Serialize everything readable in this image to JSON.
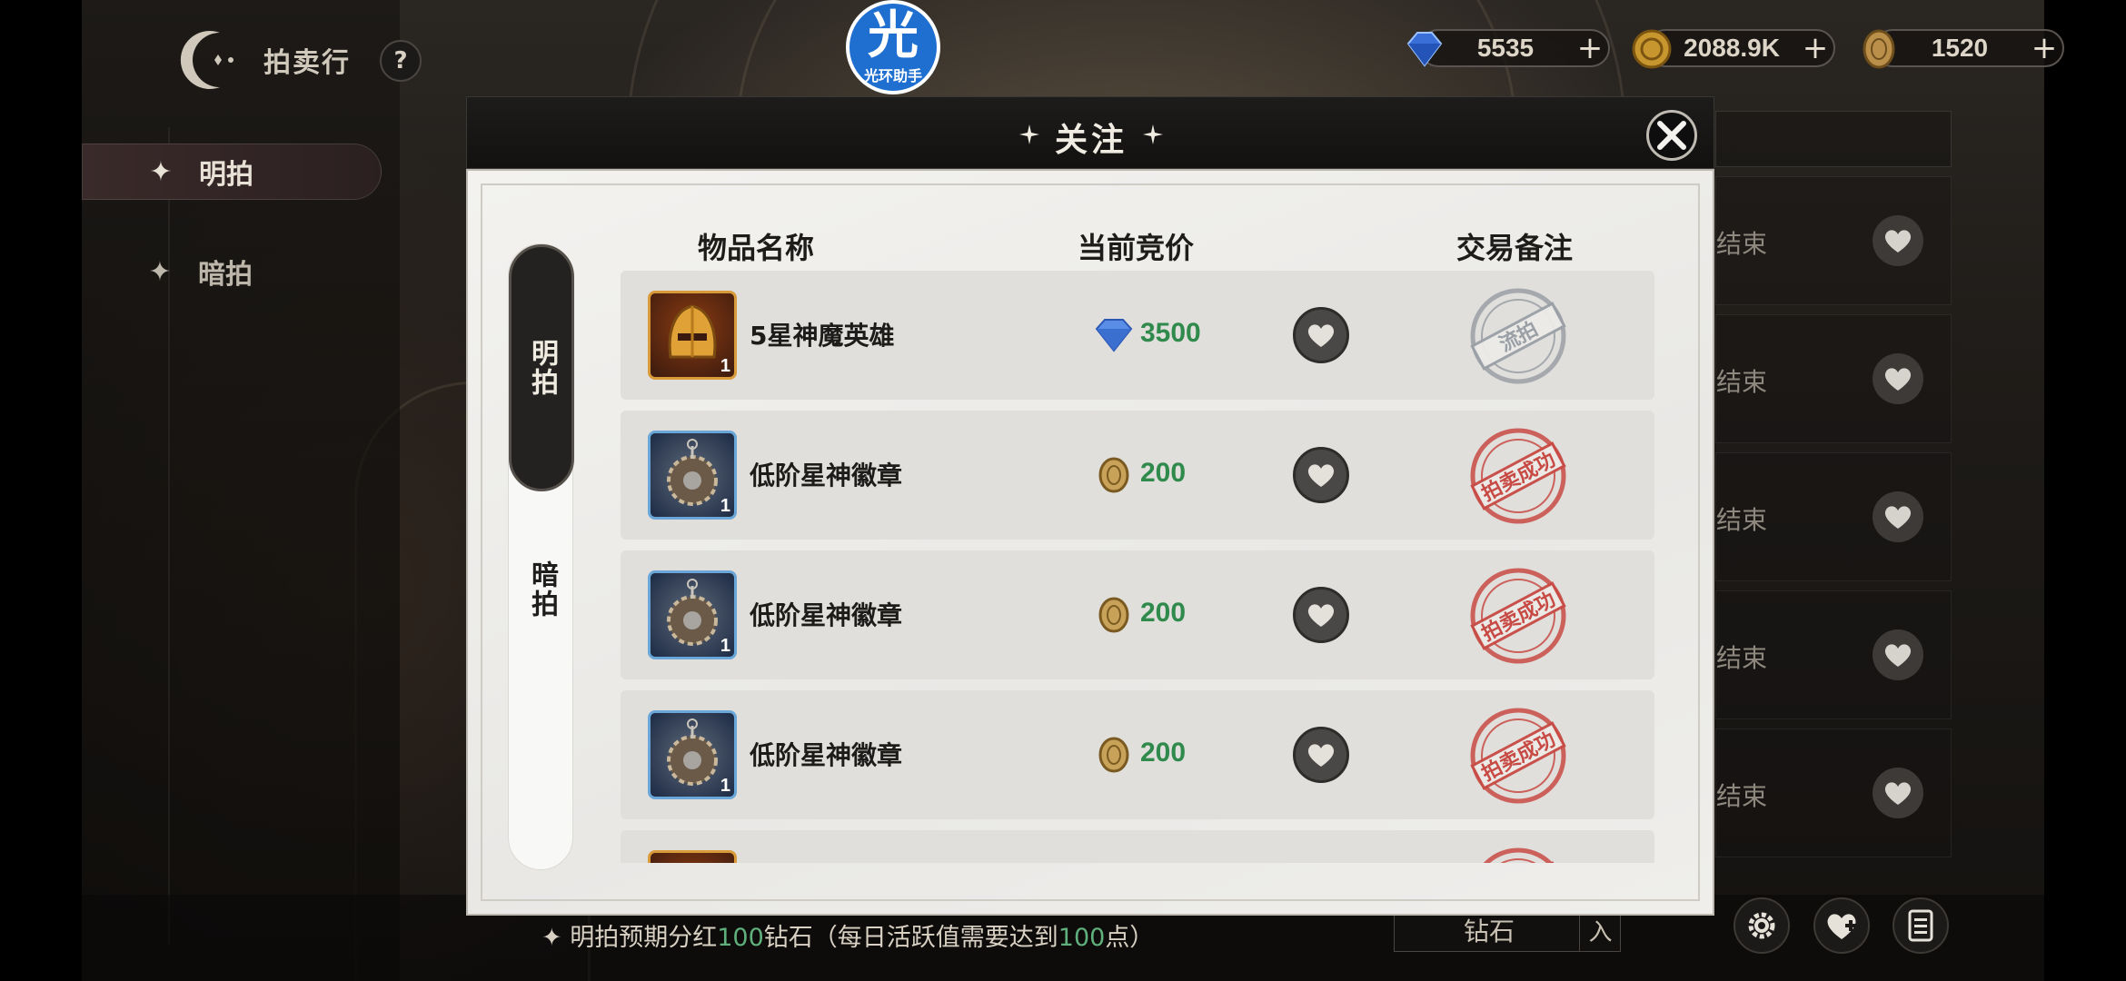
{
  "header": {
    "title": "拍卖行",
    "help_label": "?"
  },
  "watermark": {
    "big": "光",
    "small": "光环助手"
  },
  "currencies": [
    {
      "name": "diamond",
      "value": "5535",
      "plus": "+"
    },
    {
      "name": "gold",
      "value": "2088.9K",
      "plus": "+"
    },
    {
      "name": "coin",
      "value": "1520",
      "plus": "+"
    }
  ],
  "sidebar": {
    "items": [
      {
        "label": "明拍",
        "active": true
      },
      {
        "label": "暗拍",
        "active": false
      }
    ]
  },
  "background_list": {
    "rows": [
      {
        "status": "结束"
      },
      {
        "status": "结束"
      },
      {
        "status": "结束"
      },
      {
        "status": "结束"
      },
      {
        "status": "结束"
      }
    ]
  },
  "modal": {
    "title": "关注",
    "tabs": [
      {
        "label": "明拍",
        "active": true
      },
      {
        "label": "暗拍",
        "active": false
      }
    ],
    "columns": [
      "物品名称",
      "当前竞价",
      "交易备注"
    ],
    "rows": [
      {
        "name": "5星神魔英雄",
        "count": "1",
        "currency": "diamond",
        "price": "3500",
        "stamp": "流拍",
        "stamp_color": "#9aa0a6",
        "thumb": "gold"
      },
      {
        "name": "低阶星神徽章",
        "count": "1",
        "currency": "coin",
        "price": "200",
        "stamp": "拍卖成功",
        "stamp_color": "#c84a44",
        "thumb": "blue"
      },
      {
        "name": "低阶星神徽章",
        "count": "1",
        "currency": "coin",
        "price": "200",
        "stamp": "拍卖成功",
        "stamp_color": "#c84a44",
        "thumb": "blue"
      },
      {
        "name": "低阶星神徽章",
        "count": "1",
        "currency": "coin",
        "price": "200",
        "stamp": "拍卖成功",
        "stamp_color": "#c84a44",
        "thumb": "blue"
      },
      {
        "name": "",
        "count": "",
        "currency": "",
        "price": "",
        "stamp": "",
        "stamp_color": "#c84a44",
        "thumb": "gold"
      }
    ]
  },
  "bottom": {
    "tip_prefix": "明拍预期分红",
    "tip_num1": "100",
    "tip_mid": "钻石（每日活跃值需要达到",
    "tip_num2": "100",
    "tip_suffix": "点）",
    "input_value": "钻石",
    "input_btn": "入"
  },
  "colors": {
    "accent_green": "#2f8a4c",
    "stamp_red": "#c84a44",
    "stamp_gray": "#9aa0a6"
  }
}
